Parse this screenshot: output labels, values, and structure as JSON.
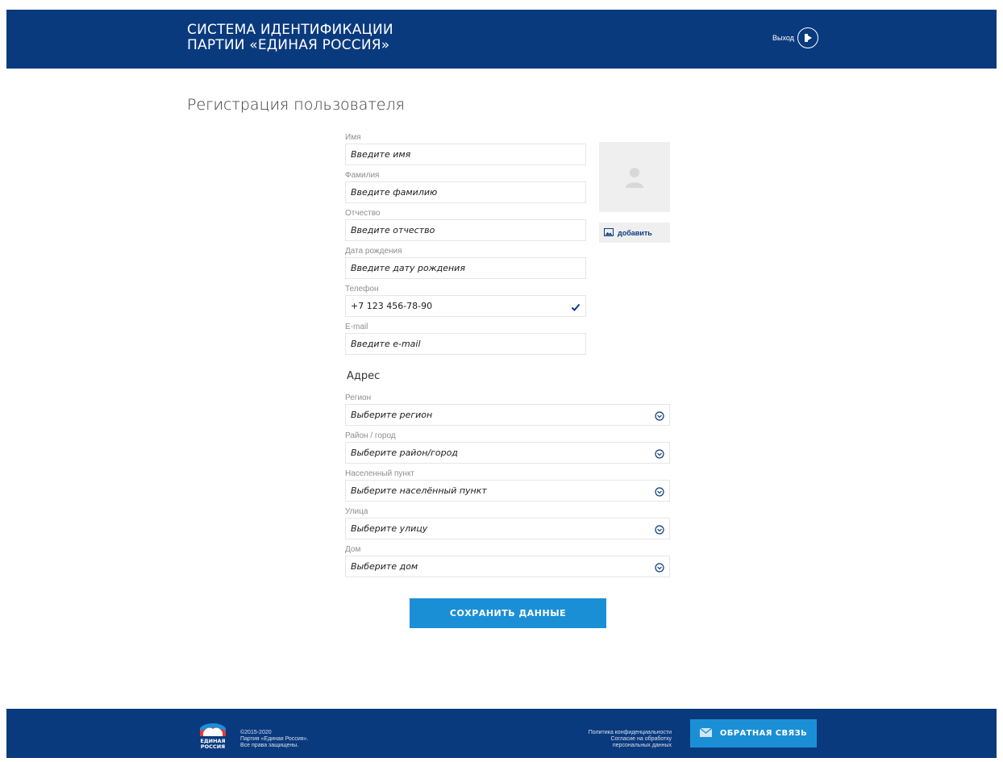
{
  "header": {
    "brand_line1": "СИСТЕМА ИДЕНТИФИКАЦИИ",
    "brand_line2": "ПАРТИИ «ЕДИНАЯ РОССИЯ»",
    "logout_label": "Выход",
    "logout_icon": "logout-icon",
    "background_color": "#0a3a7e"
  },
  "page": {
    "title": "Регистрация пользователя"
  },
  "personal": {
    "first_name": {
      "label": "Имя",
      "placeholder": "Введите имя"
    },
    "last_name": {
      "label": "Фамилия",
      "placeholder": "Введите фамилию"
    },
    "patronymic": {
      "label": "Отчество",
      "placeholder": "Введите отчество"
    },
    "birth_date": {
      "label": "Дата рождения",
      "placeholder": "Введите дату рождения"
    },
    "phone": {
      "label": "Телефон",
      "value": "+7 123 456-78-90",
      "status_icon": "checkmark-icon"
    },
    "email": {
      "label": "E-mail",
      "placeholder": "Введите e-mail"
    }
  },
  "photo": {
    "placeholder_icon": "user-avatar-icon",
    "add_label": "добавить",
    "add_icon": "image-icon"
  },
  "address": {
    "section_title": "Адрес",
    "region": {
      "label": "Регион",
      "placeholder": "Выберите регион"
    },
    "district": {
      "label": "Район / город",
      "placeholder": "Выберите район/город"
    },
    "locality": {
      "label": "Населенный пункт",
      "placeholder": "Выберите населённый пункт"
    },
    "street": {
      "label": "Улица",
      "placeholder": "Выберите улицу"
    },
    "house": {
      "label": "Дом",
      "placeholder": "Выберите дом"
    },
    "select_icon": "chevron-down-circle-icon"
  },
  "actions": {
    "save_label": "СОХРАНИТЬ ДАННЫЕ",
    "accent_color": "#1b8fd6"
  },
  "footer": {
    "logo_text_line1": "ЕДИНАЯ",
    "logo_text_line2": "РОССИЯ",
    "copyright_line1": "©2015-2020",
    "copyright_line2": "Партия «Единая Россия».",
    "copyright_line3": "Все права защищены.",
    "privacy_policy": "Политика конфиденциальности",
    "consent_line1": "Согласие на обработку",
    "consent_line2": "персональных данных",
    "feedback_label": "ОБРАТНАЯ СВЯЗЬ",
    "feedback_icon": "envelope-icon"
  }
}
